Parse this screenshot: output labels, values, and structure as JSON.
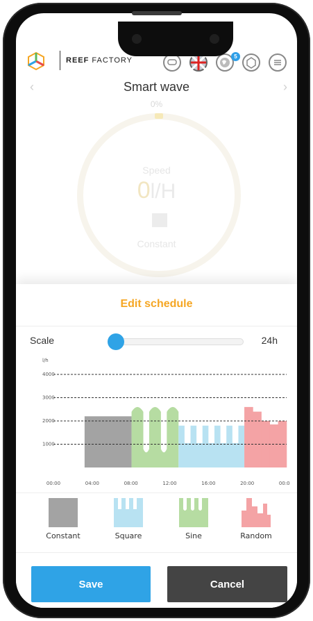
{
  "header": {
    "brand_bold": "REEF",
    "brand_rest": "FACTORY",
    "notification_count": "5",
    "icons": [
      "logo-icon",
      "chat-icon",
      "uk-flag-icon",
      "globe-icon",
      "device-settings-icon",
      "menu-icon"
    ]
  },
  "page": {
    "title": "Smart wave",
    "percent": "0%",
    "speed_label": "Speed",
    "speed_value": "0",
    "speed_unit": "l/H",
    "mode": "Constant"
  },
  "sheet": {
    "title": "Edit schedule",
    "scale_label": "Scale",
    "scale_value": "24h",
    "scale_slider_fraction": 0.0,
    "save_label": "Save",
    "cancel_label": "Cancel"
  },
  "chart_data": {
    "type": "bar",
    "ylabel": "l/h",
    "ylim": [
      0,
      4000
    ],
    "yticks": [
      "1000",
      "2000",
      "3000",
      "4000"
    ],
    "xticks": [
      "00:00",
      "04:00",
      "08:00",
      "12:00",
      "16:00",
      "20:00",
      "00:00"
    ],
    "grid": "dashed-horizontal",
    "segments": [
      {
        "name": "Constant",
        "start": "02:30",
        "end": "07:30",
        "level": 2200,
        "color": "#a3a3a3"
      },
      {
        "name": "Sine",
        "start": "07:30",
        "end": "12:30",
        "min": 800,
        "max": 2600,
        "color": "#b6dca2"
      },
      {
        "name": "Square",
        "start": "12:30",
        "end": "19:30",
        "min": 1050,
        "max": 1800,
        "color": "#b8e2f2"
      },
      {
        "name": "Random",
        "start": "19:30",
        "end": "23:59",
        "values": [
          2600,
          2400,
          2000,
          1850,
          2000
        ],
        "color": "#f4a3a5"
      }
    ]
  },
  "types": [
    {
      "label": "Constant",
      "color": "#a3a3a3",
      "icon": "constant-wave-icon"
    },
    {
      "label": "Square",
      "color": "#b8e2f2",
      "icon": "square-wave-icon"
    },
    {
      "label": "Sine",
      "color": "#b6dca2",
      "icon": "sine-wave-icon"
    },
    {
      "label": "Random",
      "color": "#f4a3a5",
      "icon": "random-wave-icon"
    }
  ]
}
